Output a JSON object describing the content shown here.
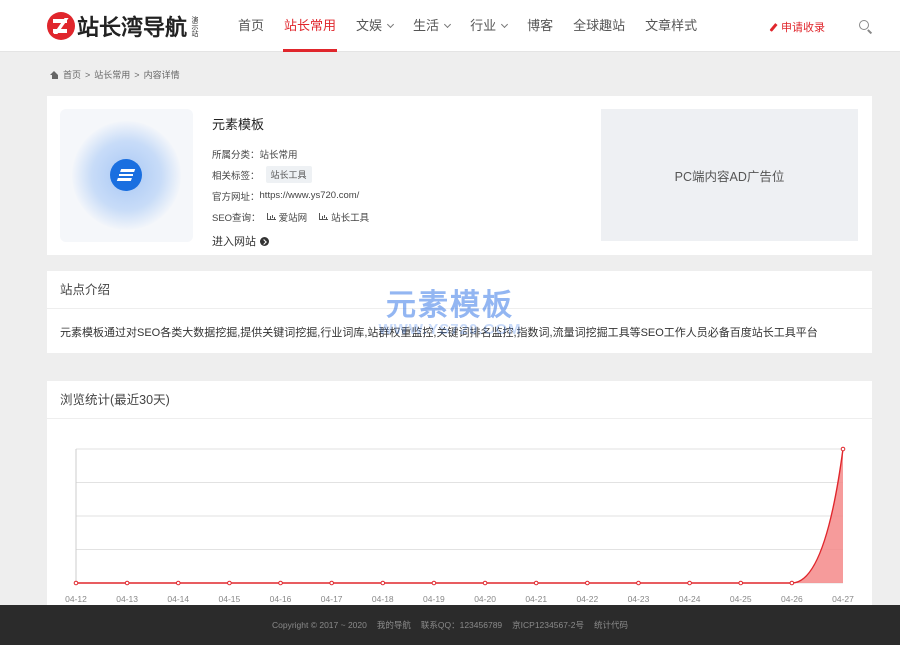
{
  "header": {
    "logo_text": "站长湾导航",
    "logo_sub": "演示站",
    "nav": [
      {
        "label": "首页",
        "dropdown": false,
        "active": false
      },
      {
        "label": "站长常用",
        "dropdown": false,
        "active": true
      },
      {
        "label": "文娱",
        "dropdown": true,
        "active": false
      },
      {
        "label": "生活",
        "dropdown": true,
        "active": false
      },
      {
        "label": "行业",
        "dropdown": true,
        "active": false
      },
      {
        "label": "博客",
        "dropdown": false,
        "active": false
      },
      {
        "label": "全球趣站",
        "dropdown": false,
        "active": false
      },
      {
        "label": "文章样式",
        "dropdown": false,
        "active": false
      }
    ],
    "apply_label": "申请收录",
    "accent_color": "#e0262c"
  },
  "breadcrumb": {
    "home": "首页",
    "category": "站长常用",
    "current": "内容详情"
  },
  "site": {
    "title": "元素模板",
    "category_label": "所属分类：",
    "category": "站长常用",
    "tags_label": "相关标签：",
    "tag": "站长工具",
    "url_label": "官方网址：",
    "url": "https://www.ys720.com/",
    "seo_label": "SEO查询：",
    "seo_links": [
      "爱站网",
      "站长工具"
    ],
    "visit_label": "进入网站"
  },
  "ad": {
    "text": "PC端内容AD广告位"
  },
  "intro": {
    "heading": "站点介绍",
    "text": "元素模板通过对SEO各类大数据挖掘,提供关键词挖掘,行业词库,站群权重监控,关键词排名监控,指数词,流量词挖掘工具等SEO工作人员必备百度站长工具平台"
  },
  "watermark": {
    "cn": "元素模板",
    "en": "WWW.YS720.COM"
  },
  "stats": {
    "heading": "浏览统计(最近30天)"
  },
  "chart_data": {
    "type": "area",
    "categories": [
      "04-12",
      "04-13",
      "04-14",
      "04-15",
      "04-16",
      "04-17",
      "04-18",
      "04-19",
      "04-20",
      "04-21",
      "04-22",
      "04-23",
      "04-24",
      "04-25",
      "04-26",
      "04-27"
    ],
    "values": [
      0,
      0,
      0,
      0,
      0,
      0,
      0,
      0,
      0,
      0,
      0,
      0,
      0,
      0,
      0,
      4
    ],
    "ylim": [
      0,
      4
    ],
    "grid": true,
    "color": "#e0262c"
  },
  "footer": {
    "copyright": "Copyright © 2017 ~ 2020",
    "links": [
      "我的导航",
      "联系QQ：123456789",
      "京ICP1234567-2号",
      "统计代码"
    ]
  }
}
